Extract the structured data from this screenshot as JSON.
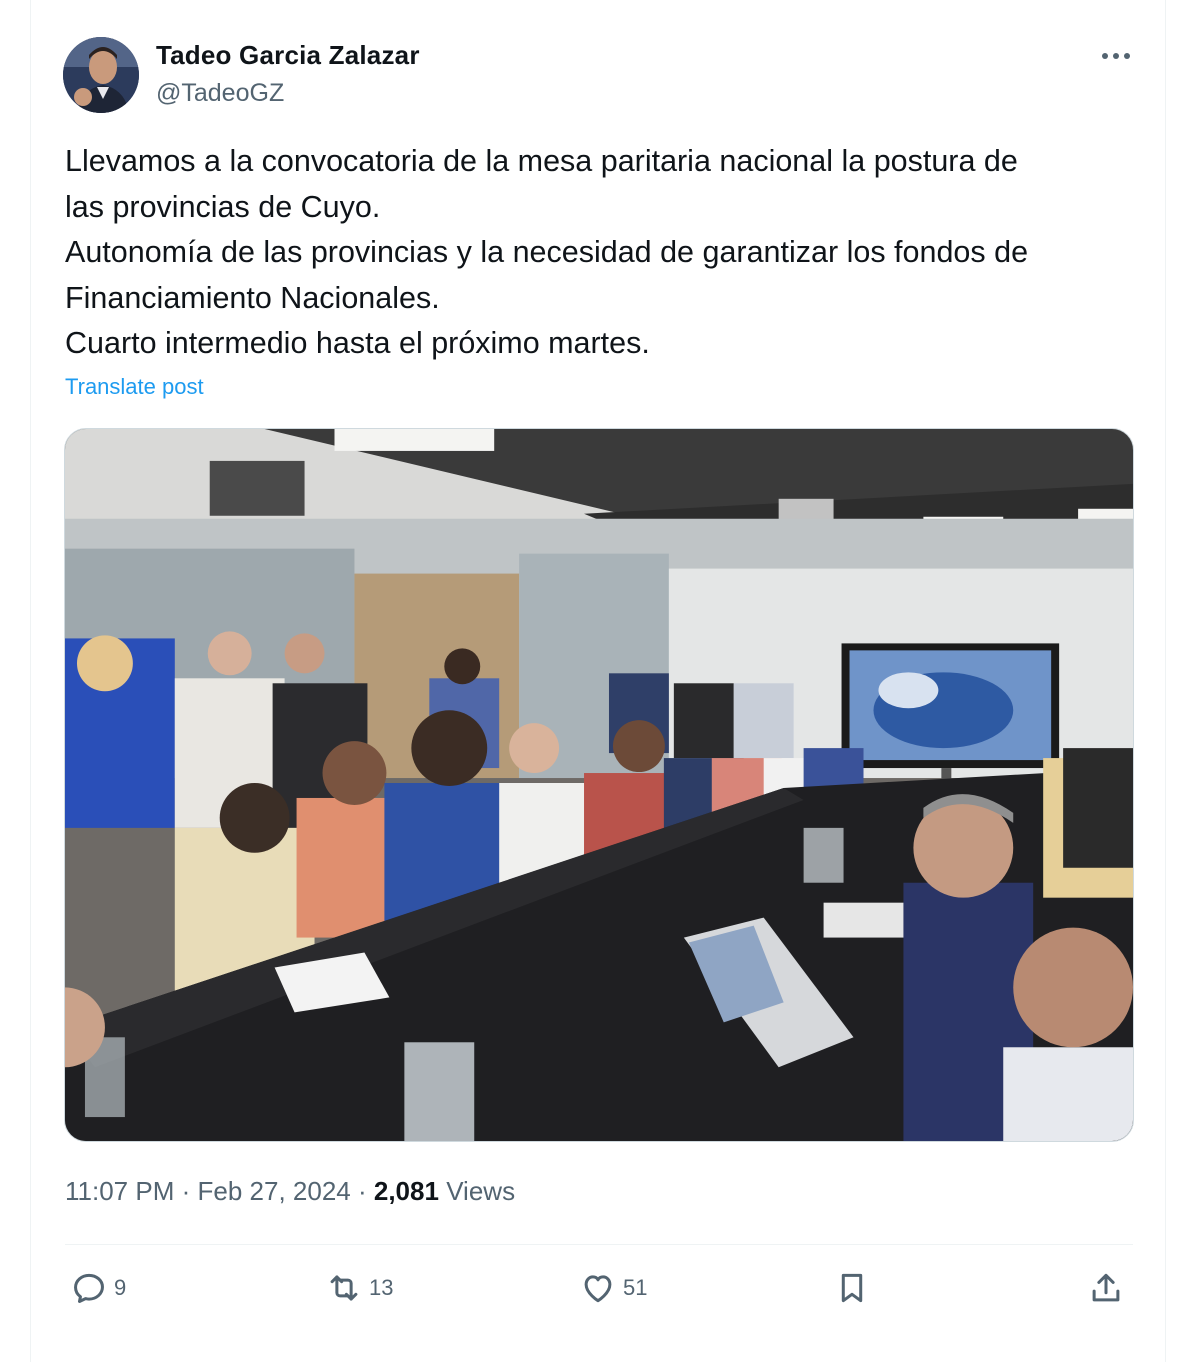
{
  "author": {
    "display_name": "Tadeo Garcia Zalazar",
    "handle": "@TadeoGZ"
  },
  "post": {
    "lines": [
      "Llevamos a la convocatoria de la mesa paritaria nacional la postura de",
      "las provincias de Cuyo.",
      "Autonomía de las provincias y la necesidad de garantizar los fondos de",
      "Financiamiento Nacionales.",
      "Cuarto intermedio hasta el próximo martes."
    ],
    "translate_label": "Translate post"
  },
  "meta": {
    "time": "11:07 PM",
    "separator": "·",
    "date": "Feb 27, 2024",
    "views_count": "2,081",
    "views_label": "Views"
  },
  "actions": {
    "replies": "9",
    "reposts": "13",
    "likes": "51"
  },
  "icons": {
    "more": "more-horizontal-icon",
    "reply": "reply-icon",
    "repost": "repost-icon",
    "like": "heart-icon",
    "bookmark": "bookmark-icon",
    "share": "share-icon"
  },
  "colors": {
    "text": "#0f1419",
    "secondary": "#536471",
    "link": "#1d9bf0",
    "border": "#eff3f4"
  }
}
